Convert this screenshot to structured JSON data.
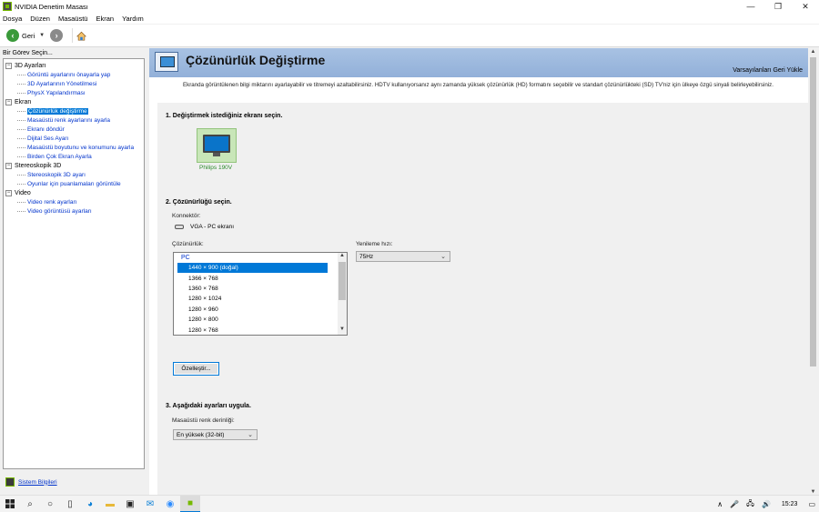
{
  "window": {
    "title": "NVIDIA Denetim Masası",
    "controls": [
      "—",
      "❐",
      "✕"
    ]
  },
  "menu": [
    "Dosya",
    "Düzen",
    "Masaüstü",
    "Ekran",
    "Yardım"
  ],
  "toolbar": {
    "back_label": "Geri"
  },
  "left_panel": {
    "task_label": "Bir Görev Seçin...",
    "tree": [
      {
        "category": "3D Ayarları",
        "items": [
          "Görüntü ayarlarını önayarla yap",
          "3D Ayarlarının Yönetilmesi",
          "PhysX Yapılandırması"
        ]
      },
      {
        "category": "Ekran",
        "items": [
          "Çözünürlük değiştirme",
          "Masaüstü renk ayarlarını ayarla",
          "Ekranı döndür",
          "Dijital Ses Ayarı",
          "Masaüstü boyutunu ve konumunu ayarla",
          "Birden Çok Ekran Ayarla"
        ]
      },
      {
        "category": "Stereoskopik 3D",
        "items": [
          "Stereoskopik 3D ayarı",
          "Oyunlar için puanlamaları görüntüle"
        ]
      },
      {
        "category": "Video",
        "items": [
          "Video renk ayarları",
          "Video görüntüsü ayarları"
        ]
      }
    ],
    "selected_item": "Çözünürlük değiştirme",
    "system_info_link": "Sistem Bilgileri"
  },
  "main": {
    "title": "Çözünürlük Değiştirme",
    "restore_defaults": "Varsayılanları Geri Yükle",
    "description": "Ekranda görüntülenen bilgi miktarını ayarlayabilir ve titremeyi azaltabilirsiniz. HDTV kullanıyorsanız aynı zamanda yüksek çözünürlük (HD) formatını seçebilir ve standart çözünürlükteki (SD) TV'niz için ülkeye özgü sinyali belirleyebilirsiniz.",
    "section1": {
      "title": "1. Değiştirmek istediğiniz ekranı seçin.",
      "display_name": "Philips 190V"
    },
    "section2": {
      "title": "2. Çözünürlüğü seçin.",
      "connector_label": "Konnektör:",
      "connector_value": "VGA - PC ekranı",
      "resolution_label": "Çözünürlük:",
      "resolution_group": "PC",
      "resolutions": [
        "1440 × 900 (doğal)",
        "1366 × 768",
        "1360 × 768",
        "1280 × 1024",
        "1280 × 960",
        "1280 × 800",
        "1280 × 768"
      ],
      "selected_resolution": "1440 × 900 (doğal)",
      "refresh_label": "Yenileme hızı:",
      "refresh_value": "75Hz",
      "customize_button": "Özelleştir..."
    },
    "section3": {
      "title": "3. Aşağıdaki ayarları uygula.",
      "color_depth_label": "Masaüstü renk derinliği:",
      "color_depth_value": "En yüksek (32-bit)"
    }
  },
  "taskbar": {
    "clock": "15:23"
  }
}
